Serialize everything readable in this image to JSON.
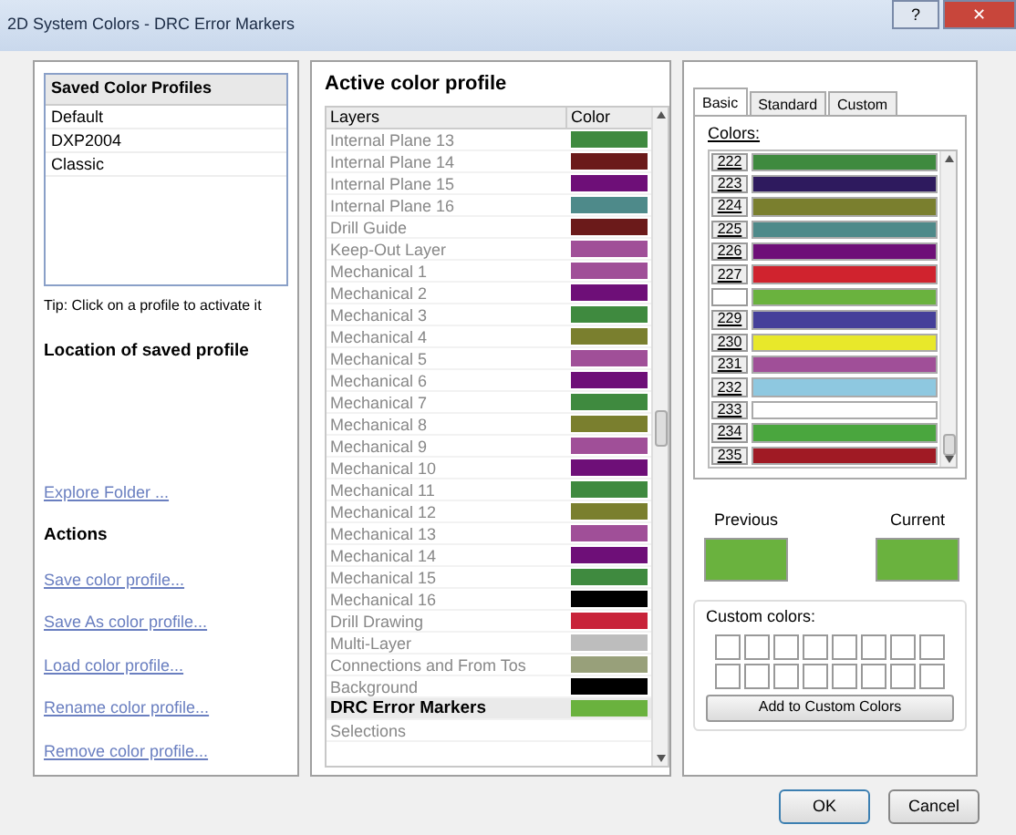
{
  "window": {
    "title": "2D System Colors - DRC Error Markers",
    "buttons": [
      "?",
      "✕"
    ]
  },
  "profiles": {
    "header": "Saved Color Profiles",
    "items": [
      {
        "label": "Default",
        "selected": false
      },
      {
        "label": "DXP2004",
        "selected": false
      },
      {
        "label": "Classic",
        "selected": false
      }
    ],
    "tip": "Tip: Click on a profile to activate it",
    "location_heading": "Location of saved profile",
    "explore_link": "Explore Folder ...",
    "actions_heading": "Actions",
    "actions": [
      "Save color profile...",
      "Save As color profile...",
      "Load color profile...",
      "Rename color profile...",
      "Remove color profile..."
    ]
  },
  "active_profile": {
    "title": "Active color profile",
    "columns": [
      "Layers",
      "Color"
    ],
    "rows": [
      {
        "name": "Internal Plane 13",
        "color": "#3f8a3f",
        "selected": false
      },
      {
        "name": "Internal Plane 14",
        "color": "#6b1a1a",
        "selected": false
      },
      {
        "name": "Internal Plane 15",
        "color": "#6e0f78",
        "selected": false
      },
      {
        "name": "Internal Plane 16",
        "color": "#4e8a8a",
        "selected": false
      },
      {
        "name": "Drill Guide",
        "color": "#6b1a1a",
        "selected": false
      },
      {
        "name": "Keep-Out Layer",
        "color": "#a04f98",
        "selected": false
      },
      {
        "name": "Mechanical 1",
        "color": "#a04f98",
        "selected": false
      },
      {
        "name": "Mechanical 2",
        "color": "#6e0f78",
        "selected": false
      },
      {
        "name": "Mechanical 3",
        "color": "#3f8a3f",
        "selected": false
      },
      {
        "name": "Mechanical 4",
        "color": "#7a7f2e",
        "selected": false
      },
      {
        "name": "Mechanical 5",
        "color": "#a04f98",
        "selected": false
      },
      {
        "name": "Mechanical 6",
        "color": "#6e0f78",
        "selected": false
      },
      {
        "name": "Mechanical 7",
        "color": "#3f8a3f",
        "selected": false
      },
      {
        "name": "Mechanical 8",
        "color": "#7a7f2e",
        "selected": false
      },
      {
        "name": "Mechanical 9",
        "color": "#a04f98",
        "selected": false
      },
      {
        "name": "Mechanical 10",
        "color": "#6e0f78",
        "selected": false
      },
      {
        "name": "Mechanical 11",
        "color": "#3f8a3f",
        "selected": false
      },
      {
        "name": "Mechanical 12",
        "color": "#7a7f2e",
        "selected": false
      },
      {
        "name": "Mechanical 13",
        "color": "#a04f98",
        "selected": false
      },
      {
        "name": "Mechanical 14",
        "color": "#6e0f78",
        "selected": false
      },
      {
        "name": "Mechanical 15",
        "color": "#3f8a3f",
        "selected": false
      },
      {
        "name": "Mechanical 16",
        "color": "#000000",
        "selected": false
      },
      {
        "name": "Drill Drawing",
        "color": "#c8233a",
        "selected": false
      },
      {
        "name": "Multi-Layer",
        "color": "#bdbdbd",
        "selected": false
      },
      {
        "name": "Connections and From Tos",
        "color": "#98a07a",
        "selected": false
      },
      {
        "name": "Background",
        "color": "#000000",
        "selected": false
      },
      {
        "name": "DRC Error Markers",
        "color": "#6ab23e",
        "selected": true
      },
      {
        "name": "Selections",
        "selected": false
      }
    ]
  },
  "color_picker": {
    "tabs": [
      {
        "label": "Basic",
        "selected": true
      },
      {
        "label": "Standard",
        "selected": false
      },
      {
        "label": "Custom",
        "selected": false
      }
    ],
    "colors_label": "Colors:",
    "colors": [
      {
        "label": "222",
        "color": "#3f8a3f",
        "selected": false
      },
      {
        "label": "223",
        "color": "#2e1a5e",
        "selected": false
      },
      {
        "label": "224",
        "color": "#7a7f2e",
        "selected": false
      },
      {
        "label": "225",
        "color": "#4e8a8a",
        "selected": false
      },
      {
        "label": "226",
        "color": "#6e0f78",
        "selected": false
      },
      {
        "label": "227",
        "color": "#d0232e",
        "selected": false
      },
      {
        "color": "#6ab23e",
        "selected": true
      },
      {
        "label": "229",
        "color": "#45409a",
        "selected": false
      },
      {
        "label": "230",
        "color": "#e8e82a",
        "selected": false
      },
      {
        "label": "231",
        "color": "#a04f98",
        "selected": false
      },
      {
        "label": "232",
        "color": "#8ec8e0",
        "selected": false
      },
      {
        "label": "233",
        "color": "#ffffff",
        "selected": false
      },
      {
        "label": "234",
        "color": "#4aa63e",
        "selected": false
      },
      {
        "label": "235",
        "color": "#a01a24",
        "selected": false
      }
    ],
    "previous": {
      "label": "Previous",
      "color": "#6ab23e"
    },
    "current": {
      "label": "Current",
      "color": "#6ab23e"
    },
    "custom_colors_label": "Custom colors:",
    "add_button": "Add to Custom Colors"
  },
  "buttons": [
    "OK",
    "Cancel"
  ]
}
